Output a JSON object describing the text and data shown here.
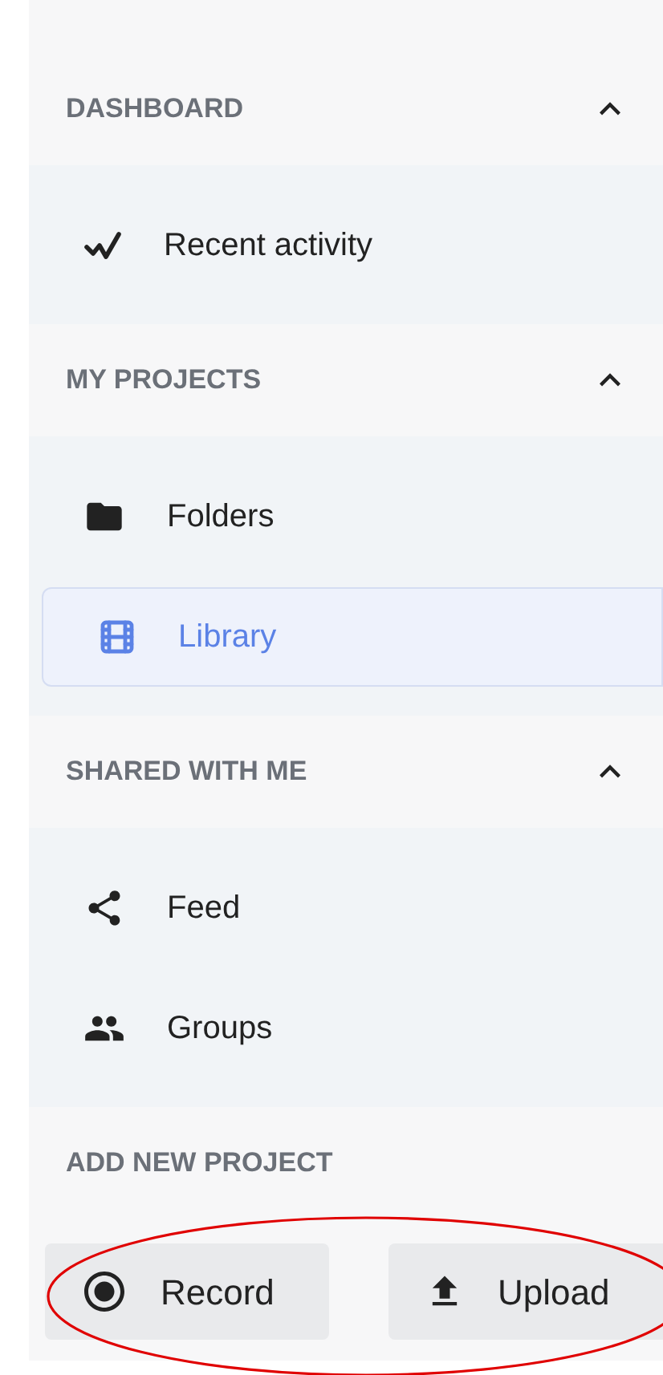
{
  "sections": [
    {
      "title": "DASHBOARD",
      "expanded": true,
      "items": [
        {
          "label": "Recent activity",
          "selected": false
        }
      ]
    },
    {
      "title": "MY PROJECTS",
      "expanded": true,
      "items": [
        {
          "label": "Folders",
          "selected": false
        },
        {
          "label": "Library",
          "selected": true
        }
      ]
    },
    {
      "title": "SHARED WITH ME",
      "expanded": true,
      "items": [
        {
          "label": "Feed",
          "selected": false
        },
        {
          "label": "Groups",
          "selected": false
        }
      ]
    }
  ],
  "add_new_project": {
    "title": "ADD NEW PROJECT",
    "highlighted": true,
    "buttons": [
      "Record",
      "Upload"
    ]
  }
}
